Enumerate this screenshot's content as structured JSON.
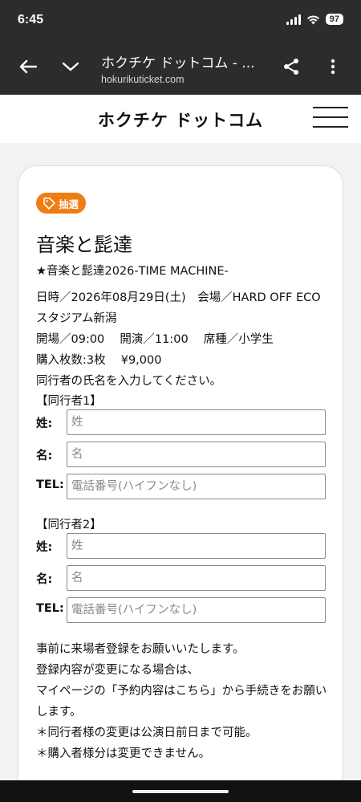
{
  "status_bar": {
    "time": "6:45",
    "battery": "97"
  },
  "browser": {
    "page_title": "ホクチケ ドットコム - ...",
    "domain": "hokurikuticket.com",
    "back_icon": "arrow-left-icon",
    "tabs_icon": "chevron-down-icon",
    "share_icon": "share-icon",
    "menu_icon": "more-vertical-icon"
  },
  "site": {
    "logo": "ホクチケ ドットコム"
  },
  "card": {
    "badge": "抽選",
    "title": "音楽と髭達",
    "subtitle": "★音楽と髭達2026-TIME MACHINE-",
    "datetime_line1": "日時／2026年08月29日(土)　会場／HARD OFF ECO",
    "datetime_line2": "スタジアム新潟",
    "open_line": "開場／09:00　 開演／11:00　 席種／小学生",
    "purchase_line": "購入枚数:3枚　 ¥9,000",
    "instruction": "同行者の氏名を入力してください。",
    "companions": [
      {
        "heading": "【同行者1】",
        "last_name_label": "姓:",
        "last_name_placeholder": "姓",
        "first_name_label": "名:",
        "first_name_placeholder": "名",
        "tel_label": "TEL:",
        "tel_placeholder": "電話番号(ハイフンなし)"
      },
      {
        "heading": "【同行者2】",
        "last_name_label": "姓:",
        "last_name_placeholder": "姓",
        "first_name_label": "名:",
        "first_name_placeholder": "名",
        "tel_label": "TEL:",
        "tel_placeholder": "電話番号(ハイフンなし)"
      }
    ],
    "notes": [
      "事前に来場者登録をお願いいたします。",
      "登録内容が変更になる場合は、",
      "マイページの「予約内容はこちら」から手続きをお願い",
      "します。",
      "＊同行者様の変更は公演日前日まで可能。",
      "＊購入者様分は変更できません。"
    ]
  },
  "colors": {
    "accent": "#ef7d12",
    "chrome": "#2c2c2f"
  }
}
